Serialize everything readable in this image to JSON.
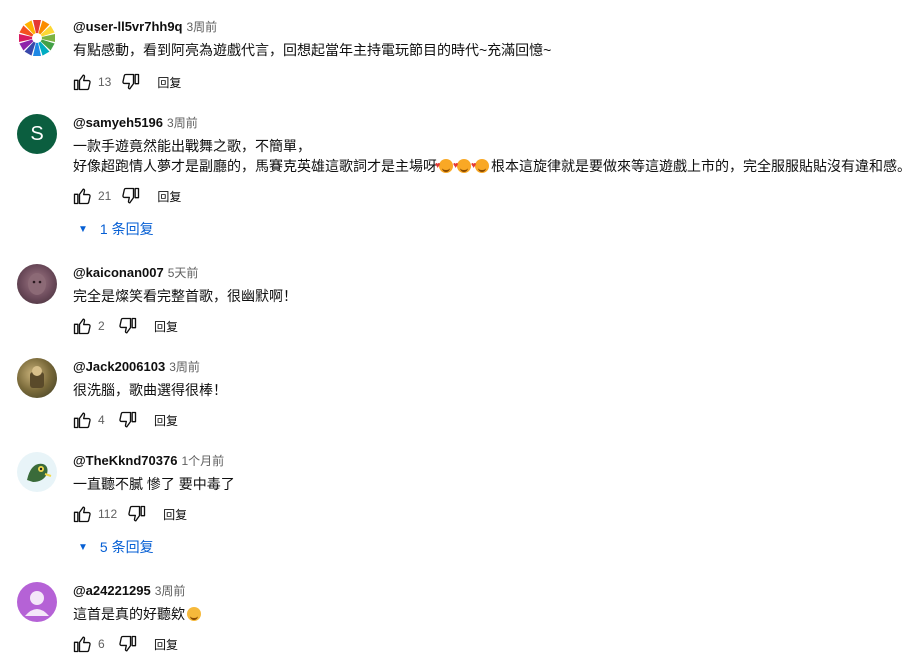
{
  "comments": [
    {
      "author": "@user-ll5vr7hh9q",
      "time": "3周前",
      "text_lines": [
        "有點感動，看到阿亮為遊戲代言，回想起當年主持電玩節目的時代~充滿回憶~"
      ],
      "likes": "13",
      "reply_label": "回复",
      "avatar": {
        "type": "spiral",
        "colors": [
          "#e53935",
          "#fb8c00",
          "#fdd835",
          "#43a047",
          "#1e88e5",
          "#8e24aa"
        ]
      }
    },
    {
      "author": "@samyeh5196",
      "time": "3周前",
      "text_lines": [
        "一款手遊竟然能出戰舞之歌，不簡單，",
        "好像超跑情人夢才是副廳的，馬賽克英雄這歌詞才是主場呀",
        "根本這旋律就是要做來等這遊戲上市的，完全服服貼貼沒有違和感。"
      ],
      "likes": "21",
      "reply_label": "回复",
      "replies_label": "1 条回复",
      "avatar": {
        "type": "letter",
        "letter": "S",
        "color": "#0b5e3f"
      }
    },
    {
      "author": "@kaiconan007",
      "time": "5天前",
      "text_lines": [
        "完全是燦笑看完整首歌，很幽默啊！"
      ],
      "likes": "2",
      "reply_label": "回复",
      "avatar": {
        "type": "photo",
        "colors": [
          "#6b4a5a",
          "#a07a86"
        ]
      }
    },
    {
      "author": "@Jack2006103",
      "time": "3周前",
      "text_lines": [
        "很洗腦，歌曲選得很棒！"
      ],
      "likes": "4",
      "reply_label": "回复",
      "avatar": {
        "type": "photo",
        "colors": [
          "#4a4a2a",
          "#c9b27a"
        ]
      }
    },
    {
      "author": "@TheKknd70376",
      "time": "1个月前",
      "text_lines": [
        "一直聽不膩 慘了 要中毒了"
      ],
      "likes": "112",
      "reply_label": "回复",
      "replies_label": "5 条回复",
      "avatar": {
        "type": "cartoon",
        "colors": [
          "#e8f4f8",
          "#3a6b3a",
          "#f2d94e"
        ]
      }
    },
    {
      "author": "@a24221295",
      "time": "3周前",
      "text_lines": [
        "這首是真的好聽欸"
      ],
      "likes": "6",
      "reply_label": "回复",
      "avatar": {
        "type": "default",
        "color": "#b562d6"
      }
    }
  ]
}
